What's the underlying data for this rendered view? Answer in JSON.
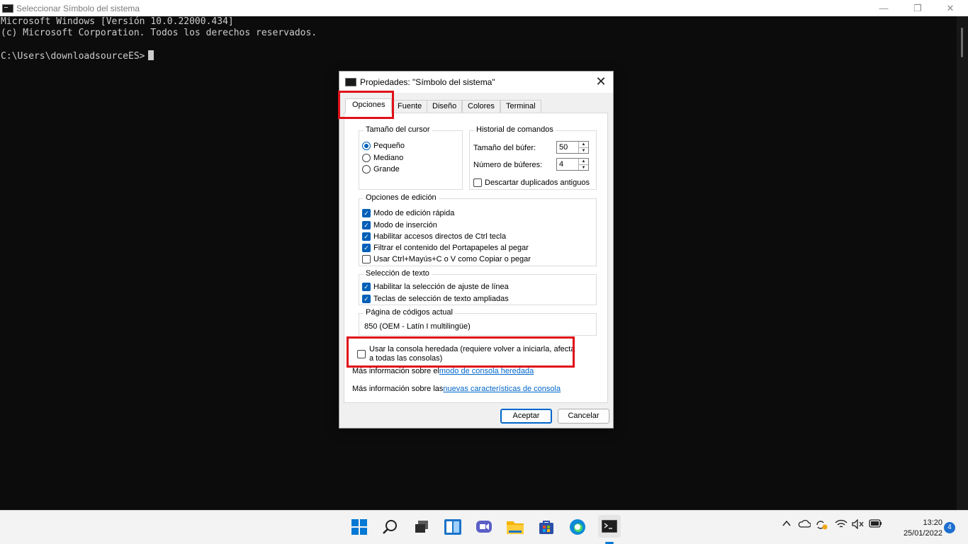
{
  "window": {
    "title": "Seleccionar Símbolo del sistema",
    "minimize_glyph": "—",
    "maximize_glyph": "❐",
    "close_glyph": "✕"
  },
  "console": {
    "line1": "Microsoft Windows [Versión 10.0.22000.434]",
    "line2": "(c) Microsoft Corporation. Todos los derechos reservados.",
    "prompt": "C:\\Users\\downloadsourceES>"
  },
  "dialog": {
    "title": "Propiedades: \"Símbolo del sistema\"",
    "close_glyph": "✕",
    "tabs": [
      "Opciones",
      "Fuente",
      "Diseño",
      "Colores",
      "Terminal"
    ],
    "active_tab": "Opciones",
    "cursor_size": {
      "label": "Tamaño del cursor",
      "options": [
        "Pequeño",
        "Mediano",
        "Grande"
      ],
      "selected": "Pequeño"
    },
    "history": {
      "label": "Historial de comandos",
      "buffer_size_label": "Tamaño del búfer:",
      "buffer_size": "50",
      "buffer_count_label": "Número de búferes:",
      "buffer_count": "4",
      "discard_label": "Descartar duplicados antiguos",
      "discard_checked": false
    },
    "edit_options": {
      "label": "Opciones de edición",
      "items": [
        {
          "label": "Modo de edición rápida",
          "checked": true
        },
        {
          "label": "Modo de inserción",
          "checked": true
        },
        {
          "label": "Habilitar accesos directos de Ctrl tecla",
          "checked": true
        },
        {
          "label": "Filtrar el contenido del Portapapeles al pegar",
          "checked": true
        },
        {
          "label": "Usar Ctrl+Mayús+C o V como Copiar o pegar",
          "checked": false
        }
      ]
    },
    "text_selection": {
      "label": "Selección de texto",
      "items": [
        {
          "label": "Habilitar la selección de ajuste de línea",
          "checked": true
        },
        {
          "label": "Teclas de selección de texto ampliadas",
          "checked": true
        }
      ]
    },
    "codepage": {
      "label": "Página de códigos actual",
      "value": "850   (OEM - Latín I multilingüe)"
    },
    "legacy": {
      "label_line1": "Usar la consola heredada (requiere volver a iniciarla, afecta",
      "label_line2": "a todas las consolas)",
      "checked": false
    },
    "more_info_1": {
      "prefix": "Más información sobre el ",
      "link": "modo de consola heredada"
    },
    "more_info_2": {
      "prefix": "Más información sobre las ",
      "link": "nuevas características de consola"
    },
    "accept_label": "Aceptar",
    "cancel_label": "Cancelar"
  },
  "taskbar": {
    "icons": [
      "windows-start-icon",
      "search-icon",
      "task-view-icon",
      "widgets-icon",
      "chat-icon",
      "file-explorer-icon",
      "store-icon",
      "edge-icon",
      "terminal-icon"
    ],
    "time": "13:20",
    "date": "25/01/2022",
    "notification_count": "4"
  },
  "colors": {
    "accent": "#005fb8",
    "highlight": "#e0101a",
    "console_bg": "#0c0c0c"
  }
}
